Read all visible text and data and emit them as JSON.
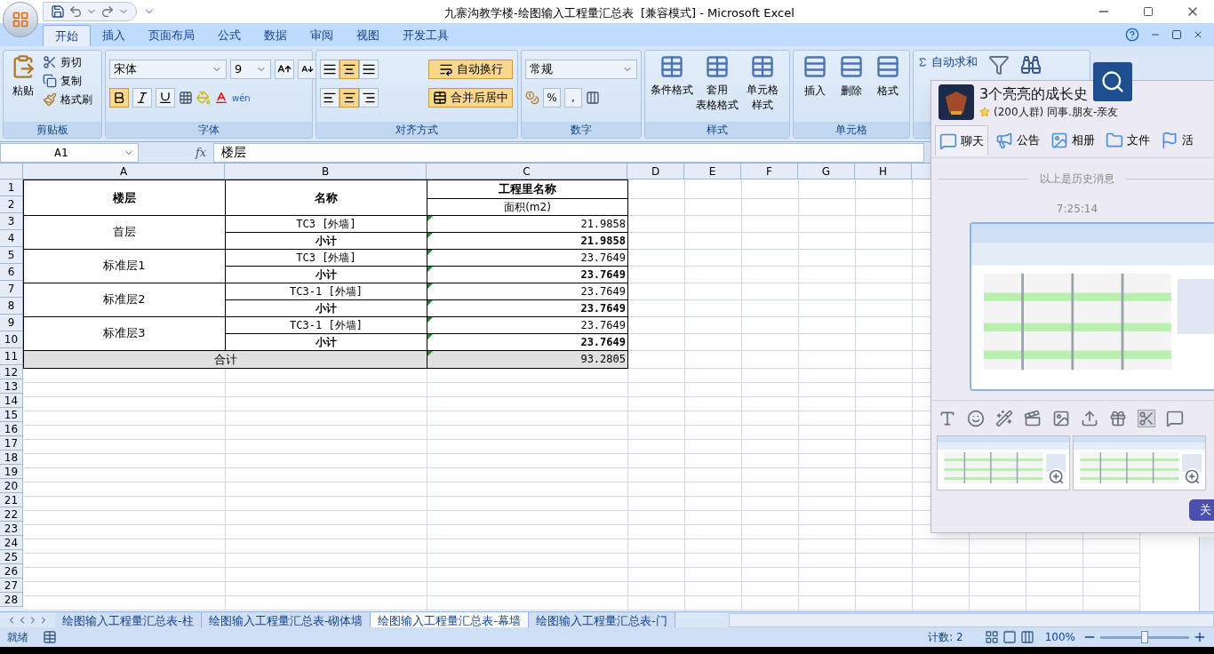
{
  "window": {
    "title": "九寨沟教学楼-绘图输入工程量汇总表  [兼容模式] - Microsoft Excel"
  },
  "ribbon_tabs": [
    {
      "label": "开始",
      "selected": true
    },
    {
      "label": "插入",
      "selected": false
    },
    {
      "label": "页面布局",
      "selected": false
    },
    {
      "label": "公式",
      "selected": false
    },
    {
      "label": "数据",
      "selected": false
    },
    {
      "label": "审阅",
      "selected": false
    },
    {
      "label": "视图",
      "selected": false
    },
    {
      "label": "开发工具",
      "selected": false
    }
  ],
  "clipboard": {
    "title": "剪贴板",
    "paste": "粘贴",
    "cut": "剪切",
    "copy": "复制",
    "painter": "格式刷"
  },
  "font": {
    "title": "字体",
    "name": "宋体",
    "size": "9",
    "bold": true,
    "italic": false,
    "underline": false,
    "phonetic": "wén"
  },
  "alignment": {
    "title": "对齐方式",
    "vertical": [
      {
        "selected": false
      },
      {
        "selected": true
      },
      {
        "selected": false
      }
    ],
    "horizontal": [
      {
        "selected": false
      },
      {
        "selected": true
      },
      {
        "selected": false
      }
    ],
    "wrap": {
      "label": "自动换行",
      "selected": true
    },
    "merge": {
      "label": "合并后居中",
      "selected": true
    }
  },
  "number": {
    "title": "数字",
    "format": "常规",
    "percent": "%",
    "comma": ","
  },
  "styles": {
    "title": "样式",
    "buttons": [
      {
        "lines": [
          "条件格式"
        ]
      },
      {
        "lines": [
          "套用",
          "表格格式"
        ]
      },
      {
        "lines": [
          "单元格",
          "样式"
        ]
      }
    ]
  },
  "cells": {
    "title": "单元格",
    "buttons": [
      "插入",
      "删除",
      "格式"
    ]
  },
  "editing": {
    "autosum": "自动求和"
  },
  "formula_bar": {
    "name_box": "A1",
    "fx": "fx",
    "value": "楼层"
  },
  "columns": [
    "A",
    "B",
    "C",
    "D",
    "E",
    "F",
    "G",
    "H"
  ],
  "row_numbers": [
    "1",
    "2",
    "3",
    "4",
    "5",
    "6",
    "7",
    "8",
    "9",
    "10",
    "11",
    "12",
    "13",
    "14",
    "15",
    "16",
    "17",
    "18",
    "19",
    "20",
    "21",
    "22",
    "23",
    "24",
    "25",
    "26",
    "27",
    "28"
  ],
  "table": {
    "floor_header": "楼层",
    "name_header": "名称",
    "group_header": "工程里名称",
    "unit_header": "面积(m2)",
    "groups": [
      {
        "floor": "首层",
        "items": [
          {
            "kind": "item",
            "name": "TC3 [外墙]",
            "value": "21.9858"
          },
          {
            "kind": "subtotal",
            "name": "小计",
            "value": "21.9858"
          }
        ]
      },
      {
        "floor": "标准层1",
        "items": [
          {
            "kind": "item",
            "name": "TC3 [外墙]",
            "value": "23.7649"
          },
          {
            "kind": "subtotal",
            "name": "小计",
            "value": "23.7649"
          }
        ]
      },
      {
        "floor": "标准层2",
        "items": [
          {
            "kind": "item",
            "name": "TC3-1 [外墙]",
            "value": "23.7649"
          },
          {
            "kind": "subtotal",
            "name": "小计",
            "value": "23.7649"
          }
        ]
      },
      {
        "floor": "标准层3",
        "items": [
          {
            "kind": "item",
            "name": "TC3-1 [外墙]",
            "value": "23.7649"
          },
          {
            "kind": "subtotal",
            "name": "小计",
            "value": "23.7649"
          }
        ]
      }
    ],
    "total_label": "合计",
    "total_value": "93.2805"
  },
  "sheet_tabs": [
    {
      "label": "绘图输入工程量汇总表-柱",
      "selected": false
    },
    {
      "label": "绘图输入工程量汇总表-砌体墙",
      "selected": false
    },
    {
      "label": "绘图输入工程量汇总表-幕墙",
      "selected": true
    },
    {
      "label": "绘图输入工程量汇总表-门",
      "selected": false
    }
  ],
  "status_bar": {
    "state": "就绪",
    "count": "计数: 2",
    "zoom": "100%"
  },
  "zoom_slider": {
    "level": 0.5
  },
  "chat": {
    "group_name": "3个亮亮的成长史",
    "subtitle": "(200人群) 同事.朋友-亲友",
    "tabs": [
      {
        "label": "聊天",
        "selected": true
      },
      {
        "label": "公告",
        "selected": false
      },
      {
        "label": "相册",
        "selected": false
      },
      {
        "label": "文件",
        "selected": false
      },
      {
        "label": "活",
        "selected": false
      }
    ],
    "history_note": "以上是历史消息",
    "time": "7:25:14",
    "close": "关"
  }
}
